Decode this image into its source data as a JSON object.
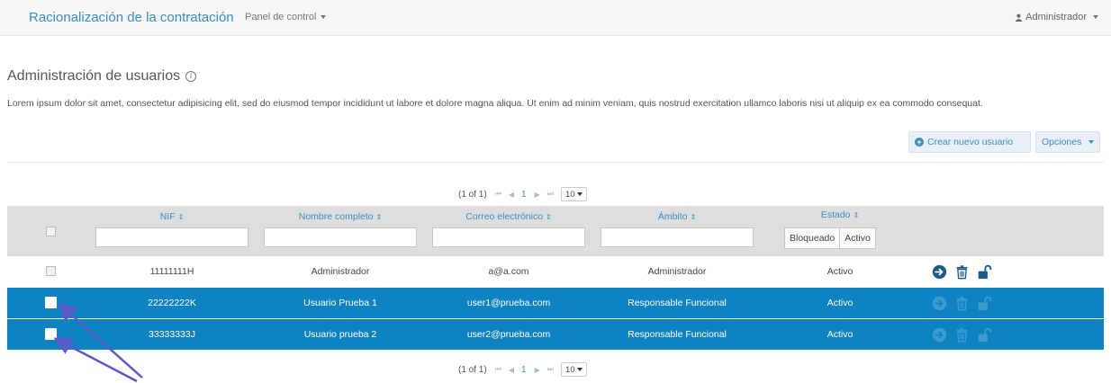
{
  "navbar": {
    "brand": "Racionalización de la contratación",
    "menu_label": "Panel de control",
    "user_label": "Administrador"
  },
  "page": {
    "title": "Administración de usuarios",
    "description": "Lorem ipsum dolor sit amet, consectetur adipisicing elit, sed do eiusmod tempor incididunt ut labore et dolore magna aliqua. Ut enim ad minim veniam, quis nostrud exercitation ullamco laboris nisi ut aliquip ex ea commodo consequat."
  },
  "actions": {
    "create_label": "Crear nuevo usuario",
    "options_label": "Opciones"
  },
  "paginator": {
    "summary": "(1 of 1)",
    "first": "⏮",
    "prev": "◀",
    "current_page": "1",
    "next": "▶",
    "last": "⏭",
    "rows_per_page": "10"
  },
  "table": {
    "columns": {
      "nif": "NIF",
      "nombre": "Nombre completo",
      "correo": "Correo electrónico",
      "ambito": "Ámbito",
      "estado": "Estado"
    },
    "sort_icon": "⇕",
    "estado_filter": {
      "blocked": "Bloqueado",
      "active": "Activo"
    },
    "rows": [
      {
        "nif": "11111111H",
        "nombre": "Administrador",
        "correo": "a@a.com",
        "ambito": "Administrador",
        "estado": "Activo",
        "selected": false
      },
      {
        "nif": "22222222K",
        "nombre": "Usuario Prueba 1",
        "correo": "user1@prueba.com",
        "ambito": "Responsable Funcional",
        "estado": "Activo",
        "selected": true
      },
      {
        "nif": "33333333J",
        "nombre": "Usuario prueba 2",
        "correo": "user2@prueba.com",
        "ambito": "Responsable Funcional",
        "estado": "Activo",
        "selected": true
      }
    ]
  },
  "icons": {
    "info": "info-circle-icon",
    "user": "user-icon",
    "create": "plus-circle-icon",
    "view": "arrow-circle-right-icon",
    "delete": "trash-icon",
    "unlock": "unlock-icon"
  },
  "colors": {
    "accent": "#3c8dbc",
    "selected_row": "#0f83c2",
    "annotation_arrow": "#5a5ac8"
  }
}
